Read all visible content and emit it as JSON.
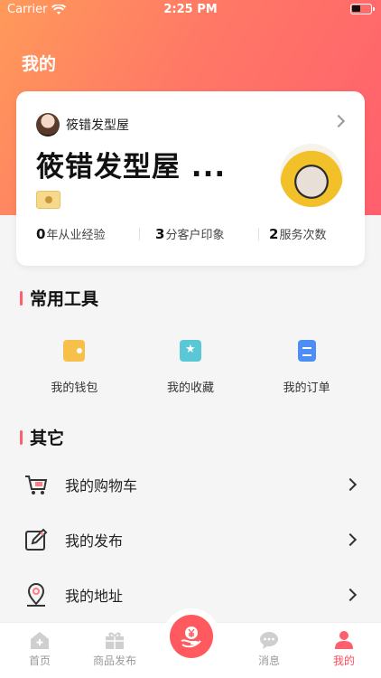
{
  "status_bar": {
    "carrier": "Carrier",
    "time": "2:25 PM"
  },
  "header": {
    "title": "我的"
  },
  "profile": {
    "shop_name_small": "筱错发型屋",
    "shop_name_large": "筱错发型屋 ...",
    "stats": [
      {
        "value": "0",
        "label": "年从业经验"
      },
      {
        "value": "3",
        "label": "分客户印象"
      },
      {
        "value": "2",
        "label": "服务次数"
      }
    ]
  },
  "tools_section": {
    "title": "常用工具",
    "items": [
      {
        "label": "我的钱包",
        "icon": "wallet-icon"
      },
      {
        "label": "我的收藏",
        "icon": "folder-star-icon"
      },
      {
        "label": "我的订单",
        "icon": "document-icon"
      }
    ]
  },
  "other_section": {
    "title": "其它",
    "items": [
      {
        "label": "我的购物车",
        "icon": "cart-icon"
      },
      {
        "label": "我的发布",
        "icon": "edit-icon"
      },
      {
        "label": "我的地址",
        "icon": "location-pin-icon"
      }
    ]
  },
  "tabbar": {
    "tabs": [
      {
        "label": "首页",
        "icon": "home-icon"
      },
      {
        "label": "商品发布",
        "icon": "gift-icon"
      },
      {
        "label": "",
        "icon": "money-hand-icon"
      },
      {
        "label": "消息",
        "icon": "chat-bubble-icon"
      },
      {
        "label": "我的",
        "icon": "person-icon",
        "active": true
      }
    ]
  },
  "colors": {
    "accent": "#ff5e6c",
    "gradient_start": "#ff9a5a",
    "gradient_end": "#ff5f6d"
  }
}
